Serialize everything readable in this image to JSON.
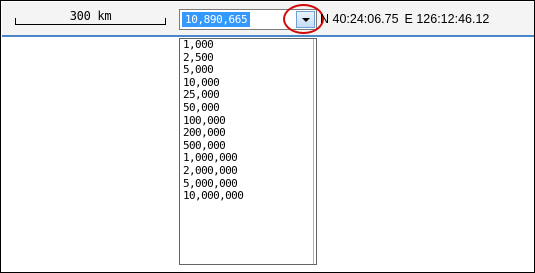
{
  "scale_bar": {
    "label": "300 km"
  },
  "zoom": {
    "current_value": "10,890,665",
    "options": [
      "1,000",
      "2,500",
      "5,000",
      "10,000",
      "25,000",
      "50,000",
      "100,000",
      "200,000",
      "500,000",
      "1,000,000",
      "2,000,000",
      "5,000,000",
      "10,000,000"
    ]
  },
  "coordinates": {
    "latitude": "N 40:24:06.75",
    "longitude": "E 126:12:46.12"
  },
  "colors": {
    "selection": "#3399ff",
    "highlight_circle": "#d20a0a",
    "toolbar_border": "#4a88c9"
  }
}
